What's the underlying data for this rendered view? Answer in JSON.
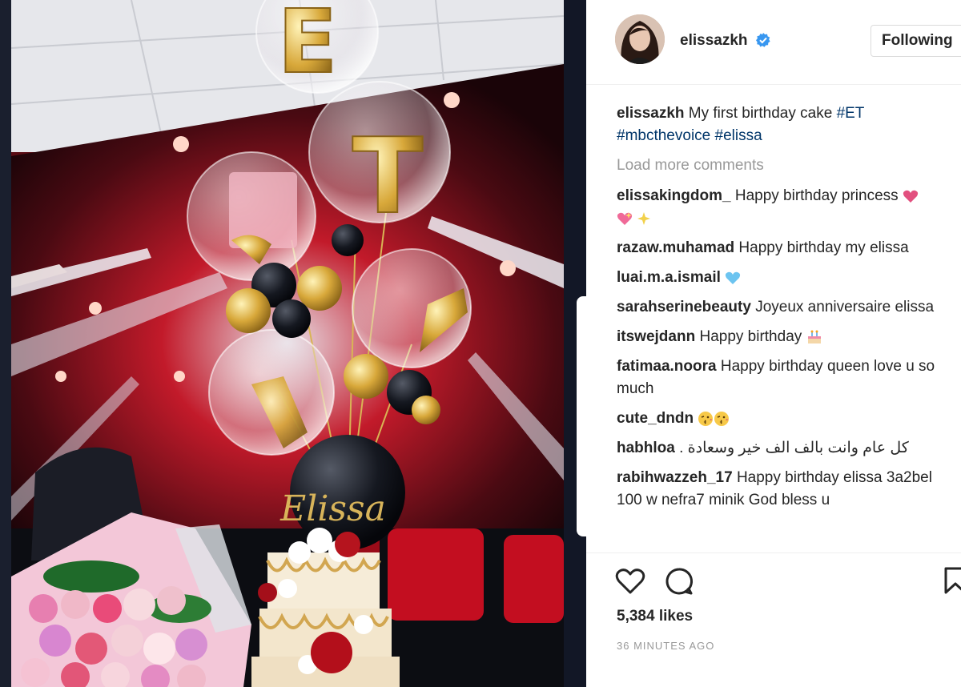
{
  "post": {
    "username": "elissazkh",
    "follow_label": "Following",
    "caption": {
      "user": "elissazkh",
      "text": " My first birthday cake ",
      "tags": [
        "#ET",
        "#mbcthevoice",
        "#elissa"
      ]
    },
    "load_more": "Load more comments",
    "comments": [
      {
        "user": "elissakingdom_",
        "text": " Happy birthday princess ",
        "emoji": [
          "purple-heart",
          "sparkling-heart",
          "sparkles"
        ]
      },
      {
        "user": "razaw.muhamad",
        "text": " Happy birthday my elissa",
        "emoji": []
      },
      {
        "user": "luai.m.a.ismail",
        "text": " ",
        "emoji": [
          "blue-heart"
        ]
      },
      {
        "user": "sarahserinebeauty",
        "text": " Joyeux anniversaire elissa",
        "emoji": []
      },
      {
        "user": "itswejdann",
        "text": " Happy birthday ",
        "emoji": [
          "birthday-cake"
        ]
      },
      {
        "user": "fatimaa.noora",
        "text": " Happy birthday queen love u so much",
        "emoji": []
      },
      {
        "user": "cute_dndn",
        "text": " ",
        "emoji": [
          "kiss-face",
          "kiss-face"
        ]
      },
      {
        "user": "habhloa",
        "text": "كل عام وانت بالف الف خير وسعادة .",
        "emoji": []
      },
      {
        "user": "rabihwazzeh_17",
        "text": " Happy birthday elissa 3a2bel 100 w nefra7 minik God bless u",
        "emoji": []
      }
    ],
    "likes": "5,384 likes",
    "time": "36 MINUTES AGO"
  },
  "photo": {
    "balloon_letters": [
      "E",
      "T"
    ],
    "balloon_text": "Elissa"
  },
  "colors": {
    "tag": "#003569",
    "verified": "#3897f0",
    "stage_red": "#c0121d"
  }
}
